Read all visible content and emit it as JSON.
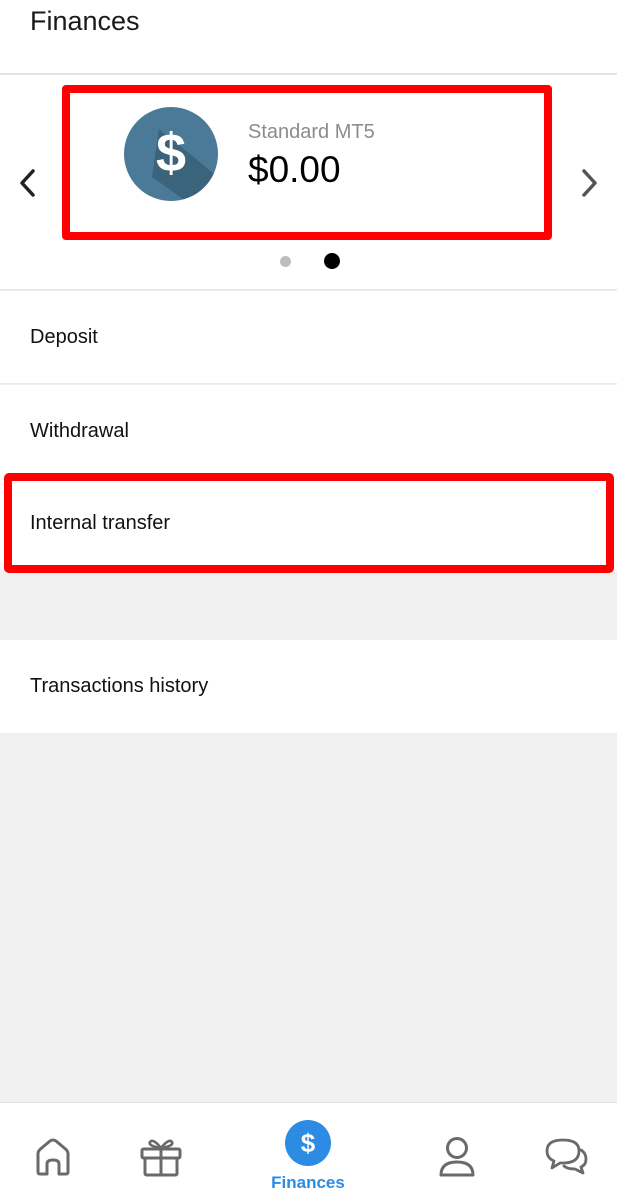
{
  "header": {
    "title": "Finances"
  },
  "account_card": {
    "name": "Standard MT5",
    "balance": "$0.00",
    "coin_symbol": "$",
    "coin_color": "#4a7a97",
    "active_page": 2,
    "page_count": 2
  },
  "menu": {
    "deposit": "Deposit",
    "withdrawal": "Withdrawal",
    "internal_transfer": "Internal transfer",
    "transactions_history": "Transactions history"
  },
  "tabbar": {
    "active_tab": "finances",
    "finances_label": "Finances",
    "finances_symbol": "$",
    "accent_color": "#2c8be3"
  },
  "icons": [
    "chevron-left-icon",
    "chevron-right-icon",
    "home-icon",
    "gift-icon",
    "dollar-icon",
    "user-icon",
    "chat-icon"
  ],
  "highlight_color": "#ff0000"
}
